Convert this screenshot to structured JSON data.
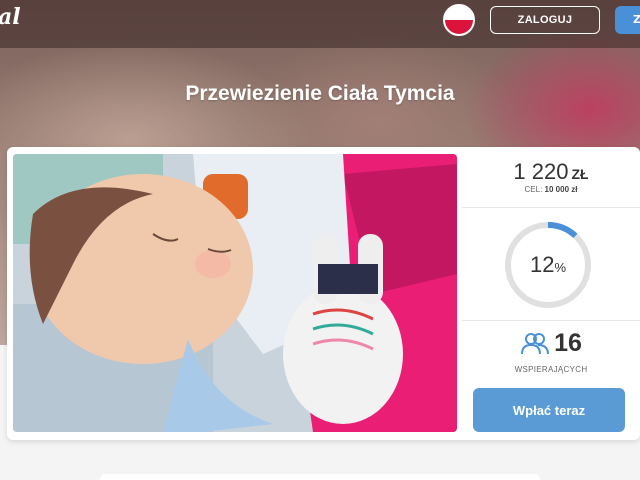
{
  "header": {
    "logo_text": "al",
    "login_label": "ZALOGUJ",
    "corner_label": "Z",
    "language_flag": "pl-flag-icon"
  },
  "campaign": {
    "title": "Przewiezienie Ciała Tymcia"
  },
  "stats": {
    "amount": "1 220",
    "currency": "ZŁ",
    "goal_label": "CEL:",
    "goal_value": "10 000 zł",
    "percent": "12",
    "percent_sign": "%",
    "progress_fraction": 0.12,
    "supporters_count": "16",
    "supporters_label": "WSPIERAJĄCYCH",
    "donate_label": "Wpłać teraz"
  },
  "colors": {
    "accent": "#5b9bd5",
    "progress_track": "#e0e0e0",
    "progress_fill": "#4a90d9",
    "flag_red": "#dc143c"
  }
}
